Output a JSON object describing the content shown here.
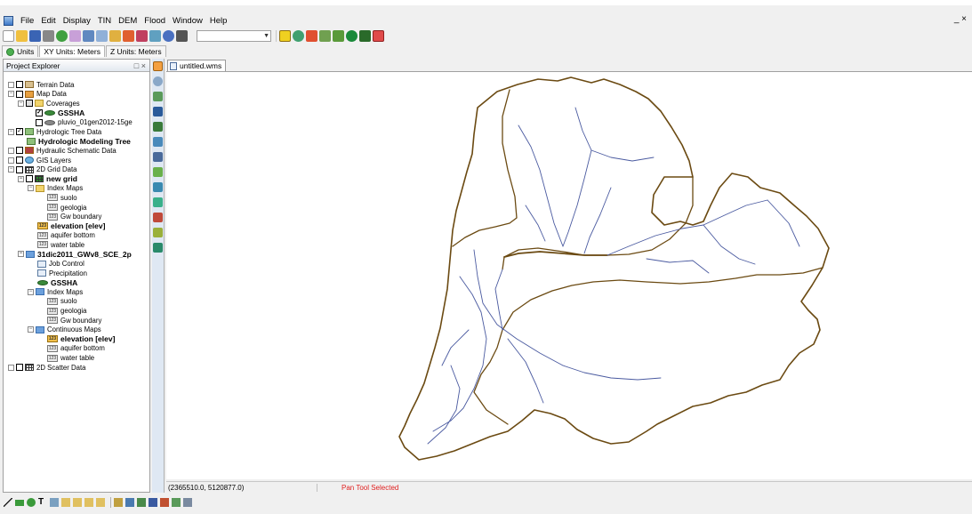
{
  "menubar": {
    "items": [
      "File",
      "Edit",
      "Display",
      "TIN",
      "DEM",
      "Flood",
      "Window",
      "Help"
    ],
    "window_controls": "_ ×"
  },
  "toolbar": {
    "combo_value": ""
  },
  "tabstrip": {
    "tabs": [
      "Units",
      "XY Units: Meters",
      "Z Units: Meters"
    ]
  },
  "explorer": {
    "title": "Project Explorer",
    "controls": "□ ×",
    "tree": [
      {
        "label": "Terrain Data",
        "icon": "terrain-icon"
      },
      {
        "label": "Map Data",
        "icon": "map-icon"
      },
      {
        "label": "Coverages",
        "icon": "folder-icon"
      },
      {
        "label": "GSSHA",
        "icon": "coverage-icon"
      },
      {
        "label": "pluvio_01gen2012-15ge",
        "icon": "coverage-icon"
      },
      {
        "label": "Hydrologic Tree Data",
        "icon": "tree-icon"
      },
      {
        "label": "Hydrologic Modeling Tree",
        "icon": "tree-icon"
      },
      {
        "label": "Hydraulic Schematic Data",
        "icon": "schematic-icon"
      },
      {
        "label": "GIS Layers",
        "icon": "gis-icon"
      },
      {
        "label": "2D Grid Data",
        "icon": "grid-icon"
      },
      {
        "label": "new grid",
        "icon": "grid-icon"
      },
      {
        "label": "Index Maps",
        "icon": "folder-icon"
      },
      {
        "label": "suolo",
        "icon": "value-icon"
      },
      {
        "label": "geologia",
        "icon": "value-icon"
      },
      {
        "label": "Gw boundary",
        "icon": "value-icon"
      },
      {
        "label": "elevation [elev]",
        "icon": "value-icon"
      },
      {
        "label": "aquifer bottom",
        "icon": "value-icon"
      },
      {
        "label": "water table",
        "icon": "value-icon"
      },
      {
        "label": "31dic2011_GWv8_SCE_2p",
        "icon": "folder-icon"
      },
      {
        "label": "Job Control",
        "icon": "job-icon"
      },
      {
        "label": "Precipitation",
        "icon": "job-icon"
      },
      {
        "label": "GSSHA",
        "icon": "coverage-icon"
      },
      {
        "label": "Index Maps",
        "icon": "folder-icon"
      },
      {
        "label": "suolo",
        "icon": "value-icon"
      },
      {
        "label": "geologia",
        "icon": "value-icon"
      },
      {
        "label": "Gw boundary",
        "icon": "value-icon"
      },
      {
        "label": "Continuous Maps",
        "icon": "folder-icon"
      },
      {
        "label": "elevation [elev]",
        "icon": "value-icon"
      },
      {
        "label": "aquifer bottom",
        "icon": "value-icon"
      },
      {
        "label": "water table",
        "icon": "value-icon"
      },
      {
        "label": "2D Scatter Data",
        "icon": "scatter-icon"
      }
    ]
  },
  "document": {
    "tab_title": "untitled.wms"
  },
  "status": {
    "coordinates": "(2365510.0, 5120877.0)",
    "tool_message": "Pan Tool Selected"
  },
  "colors": {
    "watershed_boundary": "#6b4a12",
    "stream": "#4a5aa0",
    "status_message": "#e02020"
  }
}
